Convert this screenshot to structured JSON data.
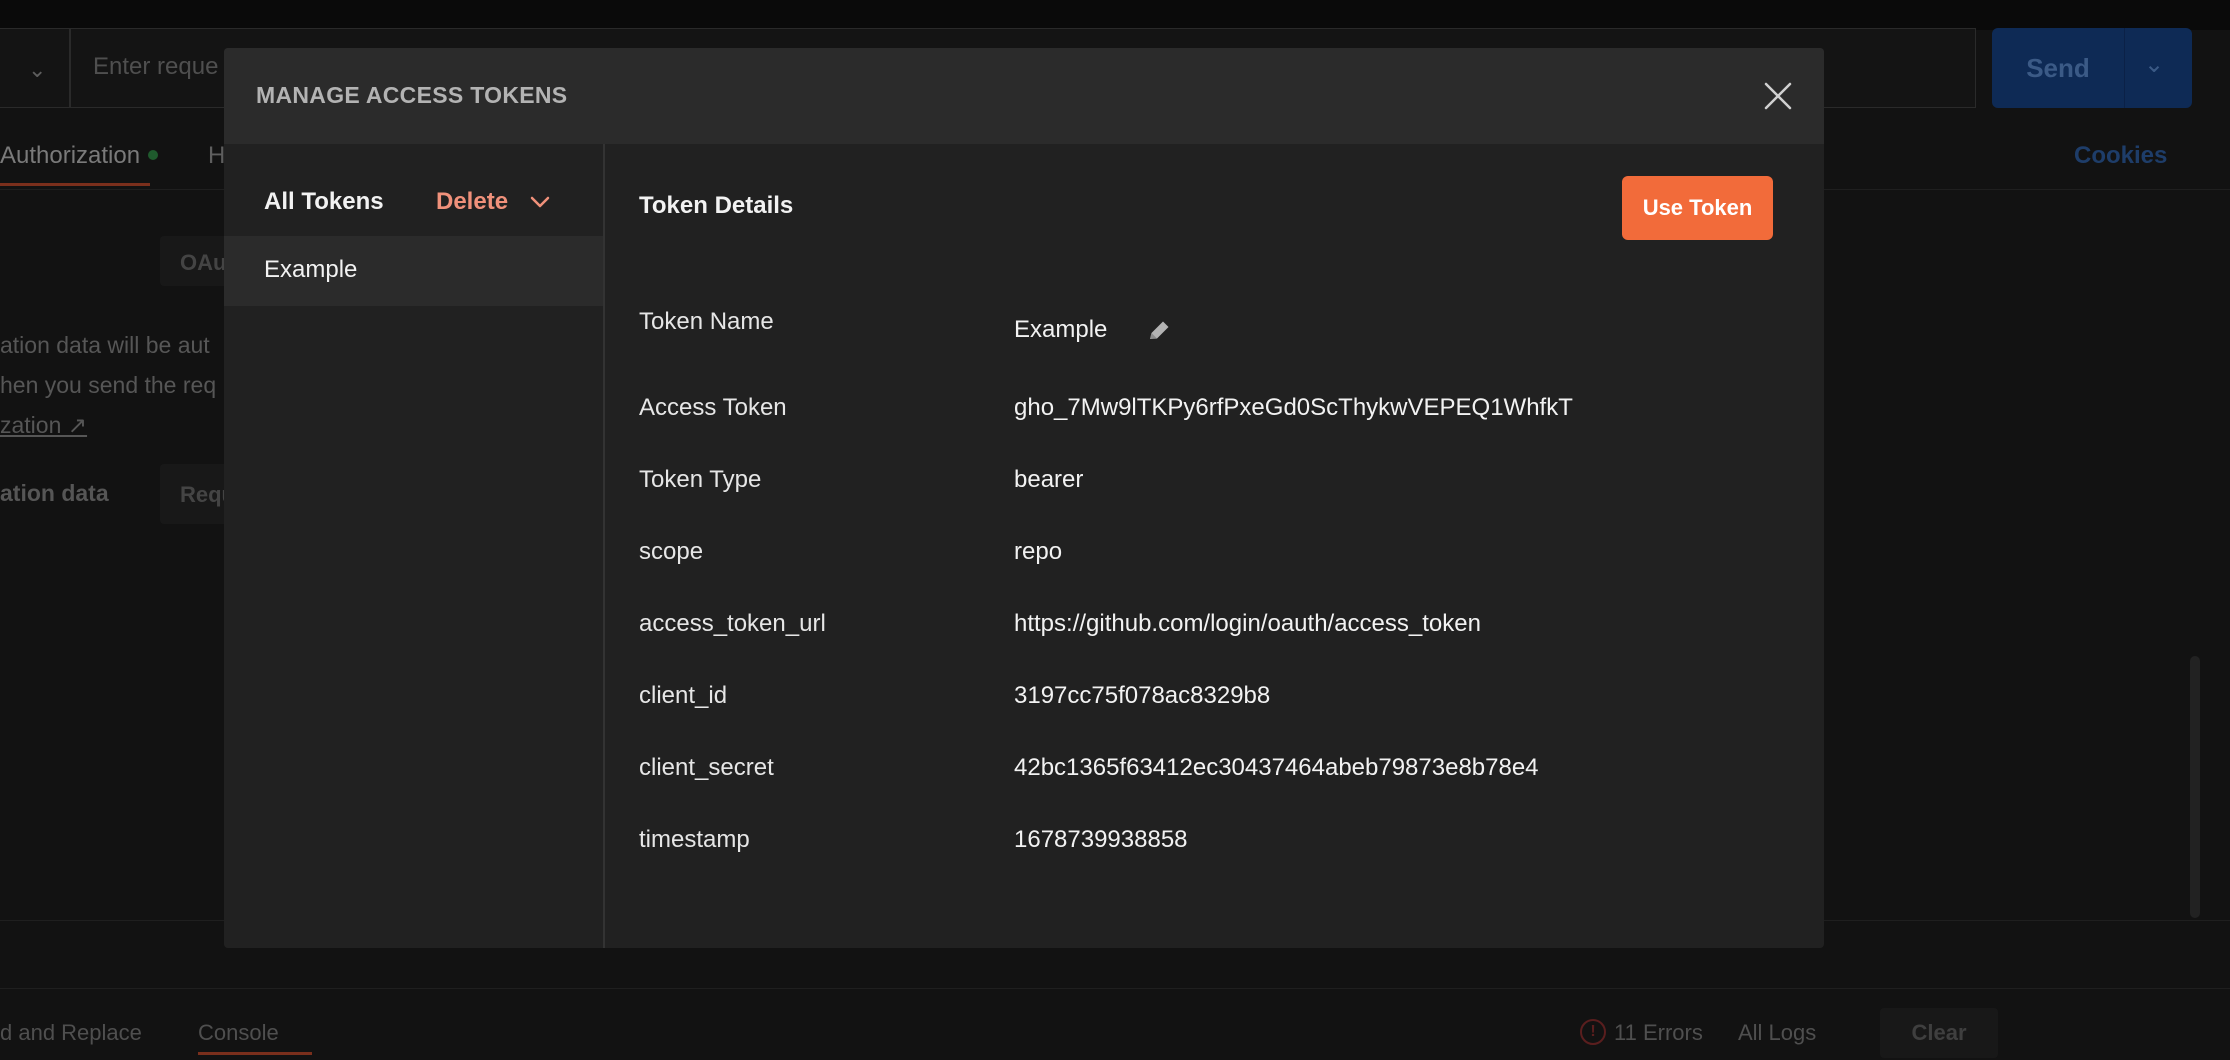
{
  "background": {
    "url_placeholder": "Enter reque",
    "send_label": "Send",
    "tab_authorization": "Authorization",
    "tab_h": "H",
    "cookies_label": "Cookies",
    "oau_chip": "OAu",
    "text_line1": "ation data will be aut",
    "text_line2": "hen you send the req",
    "text_link": "zation ↗",
    "text_data": "ation data",
    "req_chip": "Requ",
    "footer_find": "d and Replace",
    "footer_console": "Console",
    "footer_errors": "11 Errors",
    "footer_logs": "All Logs",
    "footer_clear": "Clear"
  },
  "modal": {
    "title": "MANAGE ACCESS TOKENS",
    "sidebar": {
      "title": "All Tokens",
      "delete_label": "Delete",
      "tokens": [
        "Example"
      ]
    },
    "details": {
      "title": "Token Details",
      "use_token_label": "Use Token",
      "rows": [
        {
          "key": "Token Name",
          "value": "Example"
        },
        {
          "key": "Access Token",
          "value": "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"
        },
        {
          "key": "Token Type",
          "value": "bearer"
        },
        {
          "key": "scope",
          "value": "repo"
        },
        {
          "key": "access_token_url",
          "value": "https://github.com/login/oauth/access_token"
        },
        {
          "key": "client_id",
          "value": "3197cc75f078ac8329b8"
        },
        {
          "key": "client_secret",
          "value": "42bc1365f63412ec30437464abeb79873e8b78e4"
        },
        {
          "key": "timestamp",
          "value": "1678739938858"
        }
      ]
    }
  },
  "colors": {
    "accent": "#f26b3a",
    "delete": "#f0917b",
    "modal_bg": "#212121"
  }
}
